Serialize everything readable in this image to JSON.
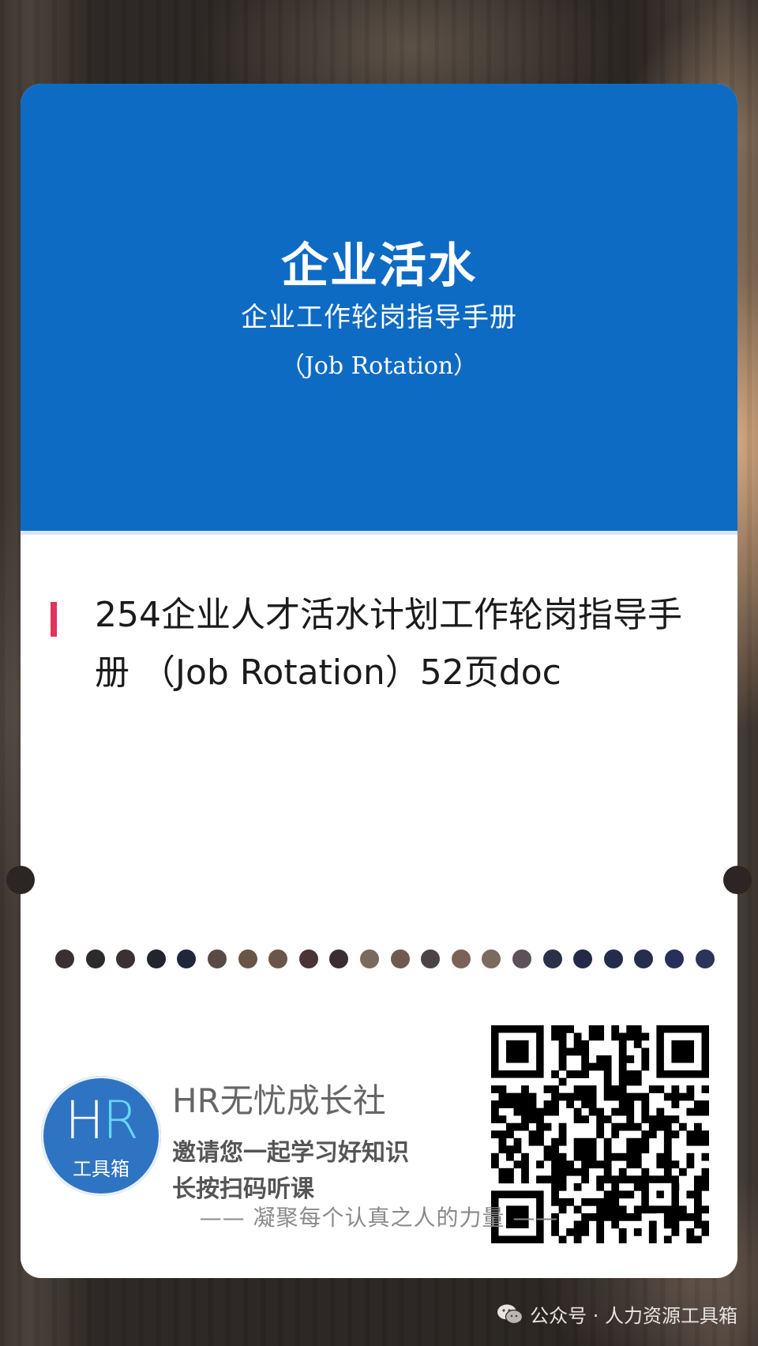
{
  "cover": {
    "title": "企业活水",
    "subtitle": "企业工作轮岗指导手册",
    "english": "（Job Rotation）",
    "color": "#0e6bc4"
  },
  "article": {
    "title": "254企业人才活水计划工作轮岗指导手册 （Job Rotation）52页doc",
    "accent_color": "#e0345c"
  },
  "promo": {
    "logo": {
      "letters_h": "H",
      "letters_r": "R",
      "caption": "工具箱",
      "color": "#2f74c2"
    },
    "brand_name": "HR无忧成长社",
    "line1": "邀请您一起学习好知识",
    "line2": "长按扫码听课",
    "qr_icon": "qr-code-icon"
  },
  "tagline": "—— 凝聚每个认真之人的力量 ——",
  "footer": {
    "source": "公众号 · 人力资源工具箱",
    "icon": "wechat-icon"
  }
}
